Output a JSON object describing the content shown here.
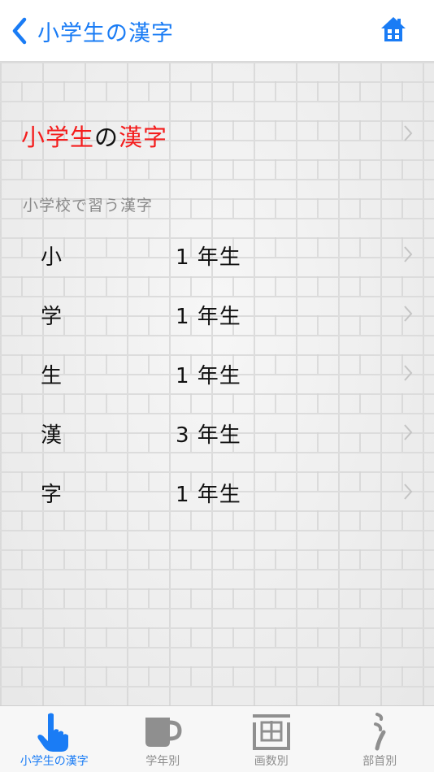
{
  "navbar": {
    "back_label": "小学生の漢字"
  },
  "header": {
    "part1": "小学生",
    "part2": "の",
    "part3": "漢字"
  },
  "section": {
    "label": "小学校で習う漢字"
  },
  "items": [
    {
      "kanji": "小",
      "grade": "1 年生"
    },
    {
      "kanji": "学",
      "grade": "1 年生"
    },
    {
      "kanji": "生",
      "grade": "1 年生"
    },
    {
      "kanji": "漢",
      "grade": "3 年生"
    },
    {
      "kanji": "字",
      "grade": "1 年生"
    }
  ],
  "tabs": [
    {
      "label": "小学生の漢字",
      "icon": "pointing-hand-icon",
      "active": true
    },
    {
      "label": "学年別",
      "icon": "mug-icon",
      "active": false
    },
    {
      "label": "画数別",
      "icon": "kanji-ga-icon",
      "active": false
    },
    {
      "label": "部首別",
      "icon": "radical-icon",
      "active": false
    }
  ],
  "colors": {
    "accent": "#1a7cf5",
    "highlight": "#f41d1d",
    "inactive_tab": "#8e8e8e"
  }
}
